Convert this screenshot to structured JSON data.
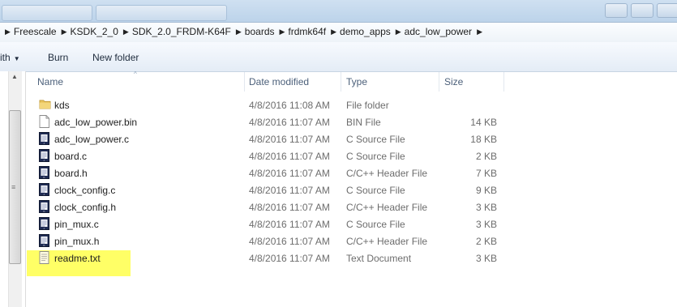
{
  "breadcrumb": [
    "Freescale",
    "KSDK_2_0",
    "SDK_2.0_FRDM-K64F",
    "boards",
    "frdmk64f",
    "demo_apps",
    "adc_low_power"
  ],
  "toolbar": {
    "share_label": "ith",
    "burn_label": "Burn",
    "new_folder_label": "New folder"
  },
  "columns": {
    "name": "Name",
    "date": "Date modified",
    "type": "Type",
    "size": "Size"
  },
  "files": [
    {
      "name": "kds",
      "date": "4/8/2016 11:08 AM",
      "type": "File folder",
      "size": "",
      "icon": "folder-icon"
    },
    {
      "name": "adc_low_power.bin",
      "date": "4/8/2016 11:07 AM",
      "type": "BIN File",
      "size": "14 KB",
      "icon": "blank-file-icon"
    },
    {
      "name": "adc_low_power.c",
      "date": "4/8/2016 11:07 AM",
      "type": "C Source File",
      "size": "18 KB",
      "icon": "c-file-icon"
    },
    {
      "name": "board.c",
      "date": "4/8/2016 11:07 AM",
      "type": "C Source File",
      "size": "2 KB",
      "icon": "c-file-icon"
    },
    {
      "name": "board.h",
      "date": "4/8/2016 11:07 AM",
      "type": "C/C++ Header File",
      "size": "7 KB",
      "icon": "h-file-icon"
    },
    {
      "name": "clock_config.c",
      "date": "4/8/2016 11:07 AM",
      "type": "C Source File",
      "size": "9 KB",
      "icon": "c-file-icon"
    },
    {
      "name": "clock_config.h",
      "date": "4/8/2016 11:07 AM",
      "type": "C/C++ Header File",
      "size": "3 KB",
      "icon": "h-file-icon"
    },
    {
      "name": "pin_mux.c",
      "date": "4/8/2016 11:07 AM",
      "type": "C Source File",
      "size": "3 KB",
      "icon": "c-file-icon"
    },
    {
      "name": "pin_mux.h",
      "date": "4/8/2016 11:07 AM",
      "type": "C/C++ Header File",
      "size": "2 KB",
      "icon": "h-file-icon"
    },
    {
      "name": "readme.txt",
      "date": "4/8/2016 11:07 AM",
      "type": "Text Document",
      "size": "3 KB",
      "icon": "text-file-icon",
      "highlighted": true
    }
  ],
  "colors": {
    "highlight": "#ffff66",
    "header_text": "#4c607a"
  }
}
